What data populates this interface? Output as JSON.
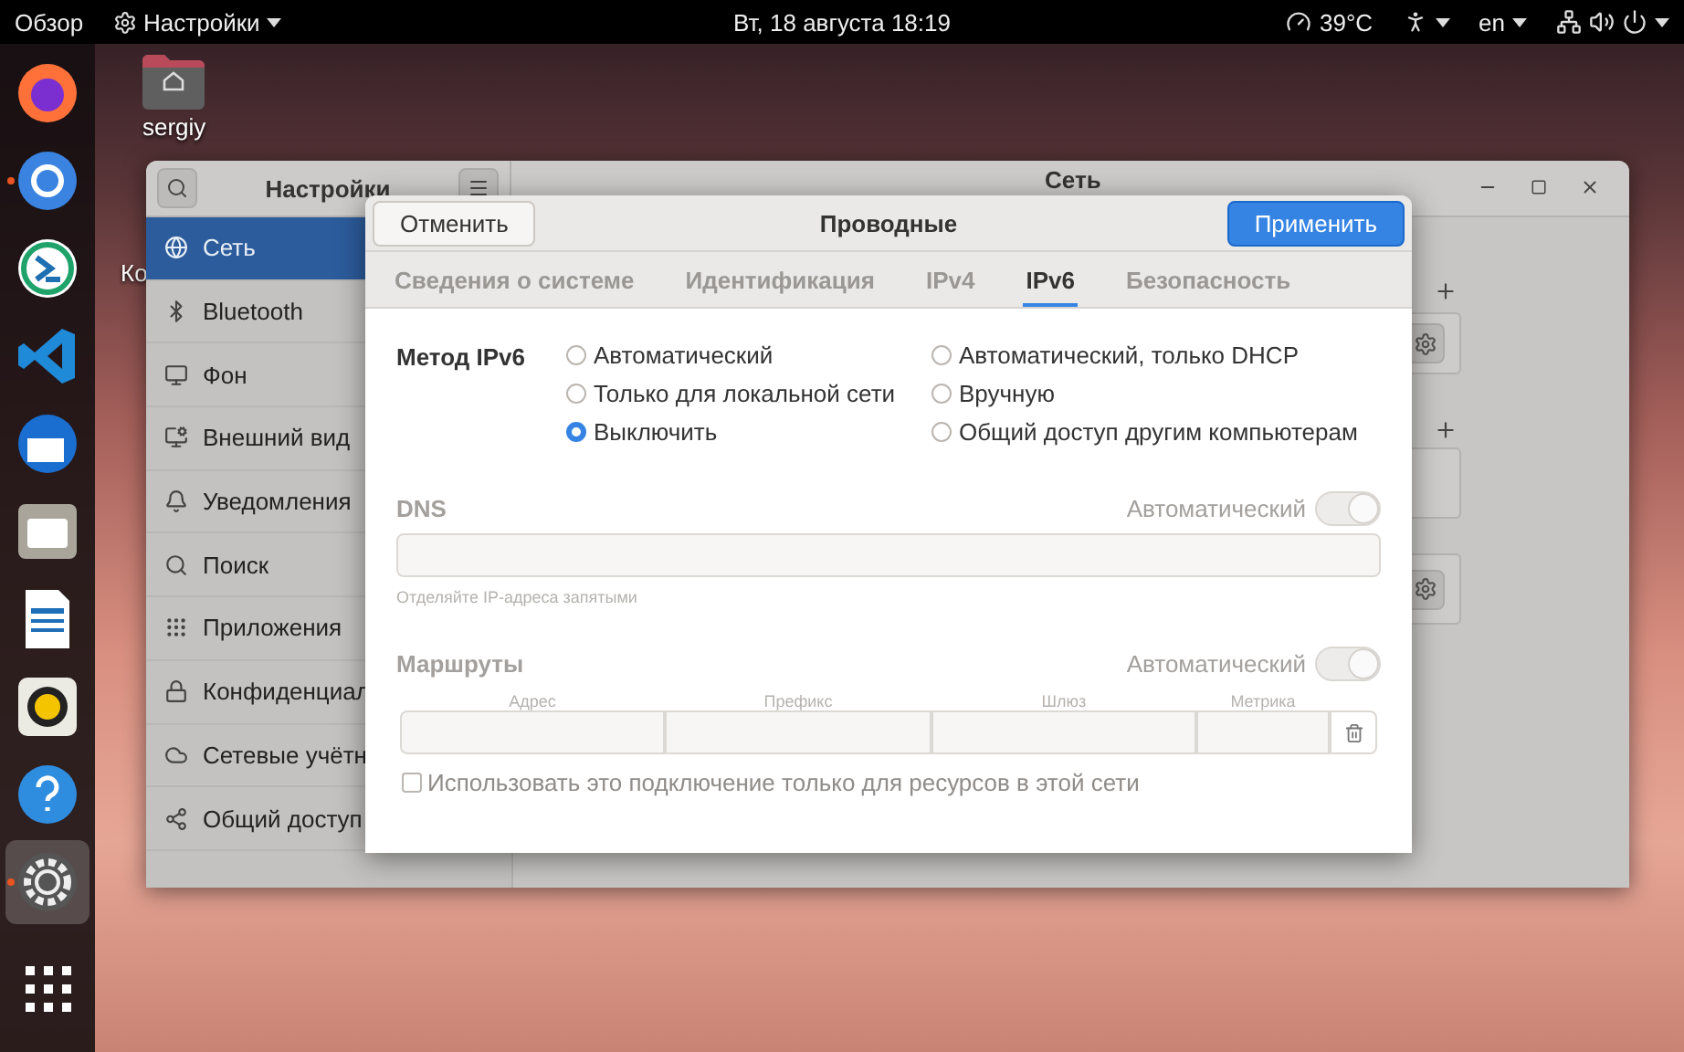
{
  "top_bar": {
    "activities": "Обзор",
    "app_menu": "Настройки",
    "clock": "Вт, 18 августа  18:19",
    "temperature": "39°C",
    "language": "en"
  },
  "dock": [
    {
      "kind": "firefox",
      "running": false,
      "selected": false
    },
    {
      "kind": "chromium",
      "running": true,
      "selected": false
    },
    {
      "kind": "remote",
      "running": false,
      "selected": false
    },
    {
      "kind": "code",
      "running": false,
      "selected": false
    },
    {
      "kind": "mail",
      "running": false,
      "selected": false
    },
    {
      "kind": "files",
      "running": false,
      "selected": false
    },
    {
      "kind": "writer",
      "running": false,
      "selected": false
    },
    {
      "kind": "music",
      "running": false,
      "selected": false
    },
    {
      "kind": "help",
      "running": false,
      "selected": false
    },
    {
      "kind": "settings",
      "running": true,
      "selected": true
    },
    {
      "kind": "apps",
      "running": false,
      "selected": false
    }
  ],
  "desktop_icons": [
    {
      "label": "sergiy"
    },
    {
      "label": "Ко"
    }
  ],
  "settings": {
    "title": "Настройки",
    "pane_title": "Сеть",
    "sidebar": [
      {
        "label": "Сеть",
        "selected": true
      },
      {
        "label": "Bluetooth",
        "selected": false
      },
      {
        "label": "Фон",
        "selected": false
      },
      {
        "label": "Внешний вид",
        "selected": false
      },
      {
        "label": "Уведомления",
        "selected": false
      },
      {
        "label": "Поиск",
        "selected": false
      },
      {
        "label": "Приложения",
        "selected": false
      },
      {
        "label": "Конфиденциал",
        "selected": false
      },
      {
        "label": "Сетевые учётн",
        "selected": false
      },
      {
        "label": "Общий доступ",
        "selected": false
      }
    ]
  },
  "dialog": {
    "title": "Проводные",
    "cancel": "Отменить",
    "apply": "Применить",
    "tabs": [
      {
        "label": "Сведения о системе",
        "selected": false
      },
      {
        "label": "Идентификация",
        "selected": false
      },
      {
        "label": "IPv4",
        "selected": false
      },
      {
        "label": "IPv6",
        "selected": true
      },
      {
        "label": "Безопасность",
        "selected": false
      }
    ],
    "method_label": "Метод IPv6",
    "methods": [
      {
        "label": "Автоматический",
        "selected": false
      },
      {
        "label": "Автоматический, только DHCP",
        "selected": false
      },
      {
        "label": "Только для локальной сети",
        "selected": false
      },
      {
        "label": "Вручную",
        "selected": false
      },
      {
        "label": "Выключить",
        "selected": true
      },
      {
        "label": "Общий доступ другим компьютерам",
        "selected": false
      }
    ],
    "dns": {
      "label": "DNS",
      "auto_label": "Автоматический",
      "on": true,
      "disabled": true,
      "hint": "Отделяйте IP-адреса запятыми"
    },
    "routes": {
      "label": "Маршруты",
      "auto_label": "Автоматический",
      "on": true,
      "disabled": true,
      "columns": [
        "Адрес",
        "Префикс",
        "Шлюз",
        "Метрика"
      ]
    },
    "local_only": {
      "label": "Использовать это подключение только для ресурсов в этой сети",
      "checked": false
    }
  }
}
